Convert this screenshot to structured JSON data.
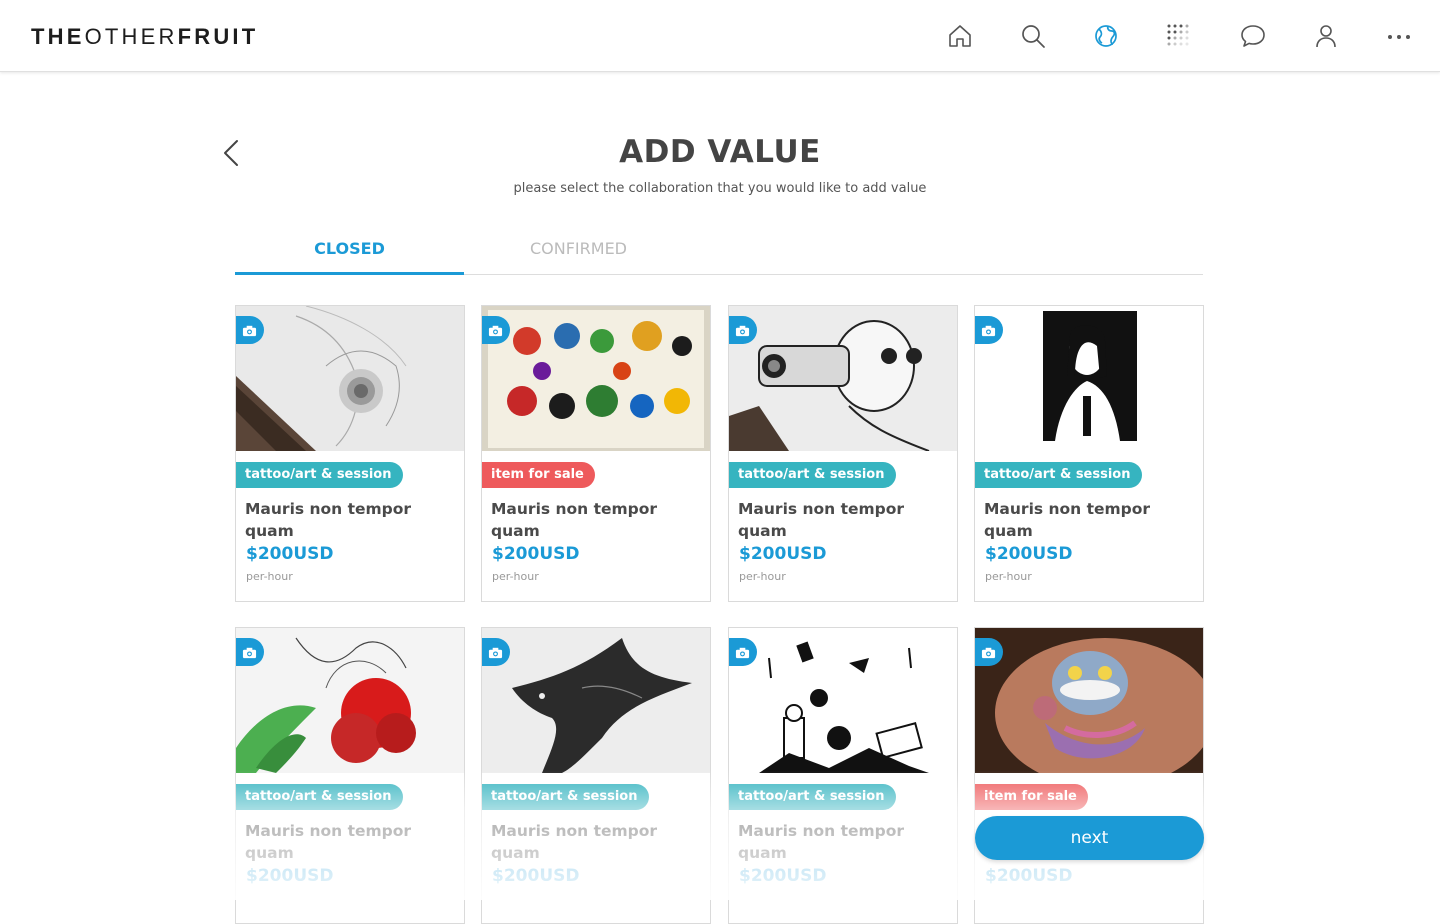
{
  "app": {
    "logo_bold_1": "THE",
    "logo_light": "OTHER",
    "logo_bold_2": "FRUIT"
  },
  "nav": {
    "icons": [
      "home-icon",
      "search-icon",
      "globe-icon",
      "dot-grid-icon",
      "chat-bubble-icon",
      "user-icon",
      "more-icon"
    ],
    "active": "globe-icon",
    "accent": "#1b9ad6"
  },
  "page": {
    "title": "ADD VALUE",
    "subtitle": "please select the collaboration that you would like to add value",
    "back_icon": "chevron-left-icon"
  },
  "tabs": [
    {
      "label": "CLOSED",
      "active": true
    },
    {
      "label": "CONFIRMED",
      "active": false
    }
  ],
  "cards": [
    {
      "tag": "tattoo/art & session",
      "tag_color": "#36b4c0",
      "title": "Mauris non tempor quam",
      "price": "$200USD",
      "unit": "per-hour"
    },
    {
      "tag": "item for sale",
      "tag_color": "#ee5a5c",
      "title": "Mauris non tempor quam",
      "price": "$200USD",
      "unit": "per-hour"
    },
    {
      "tag": "tattoo/art & session",
      "tag_color": "#36b4c0",
      "title": "Mauris non tempor quam",
      "price": "$200USD",
      "unit": "per-hour"
    },
    {
      "tag": "tattoo/art & session",
      "tag_color": "#36b4c0",
      "title": "Mauris non tempor quam",
      "price": "$200USD",
      "unit": "per-hour"
    },
    {
      "tag": "tattoo/art & session",
      "tag_color": "#36b4c0",
      "title": "Mauris non tempor quam",
      "price": "$200USD",
      "unit": ""
    },
    {
      "tag": "tattoo/art & session",
      "tag_color": "#36b4c0",
      "title": "Mauris non tempor quam",
      "price": "$200USD",
      "unit": ""
    },
    {
      "tag": "tattoo/art & session",
      "tag_color": "#36b4c0",
      "title": "Mauris non tempor quam",
      "price": "$200USD",
      "unit": ""
    },
    {
      "tag": "item for sale",
      "tag_color": "#ee5a5c",
      "title": "",
      "price": "$200USD",
      "unit": ""
    }
  ],
  "actions": {
    "next_label": "next"
  }
}
